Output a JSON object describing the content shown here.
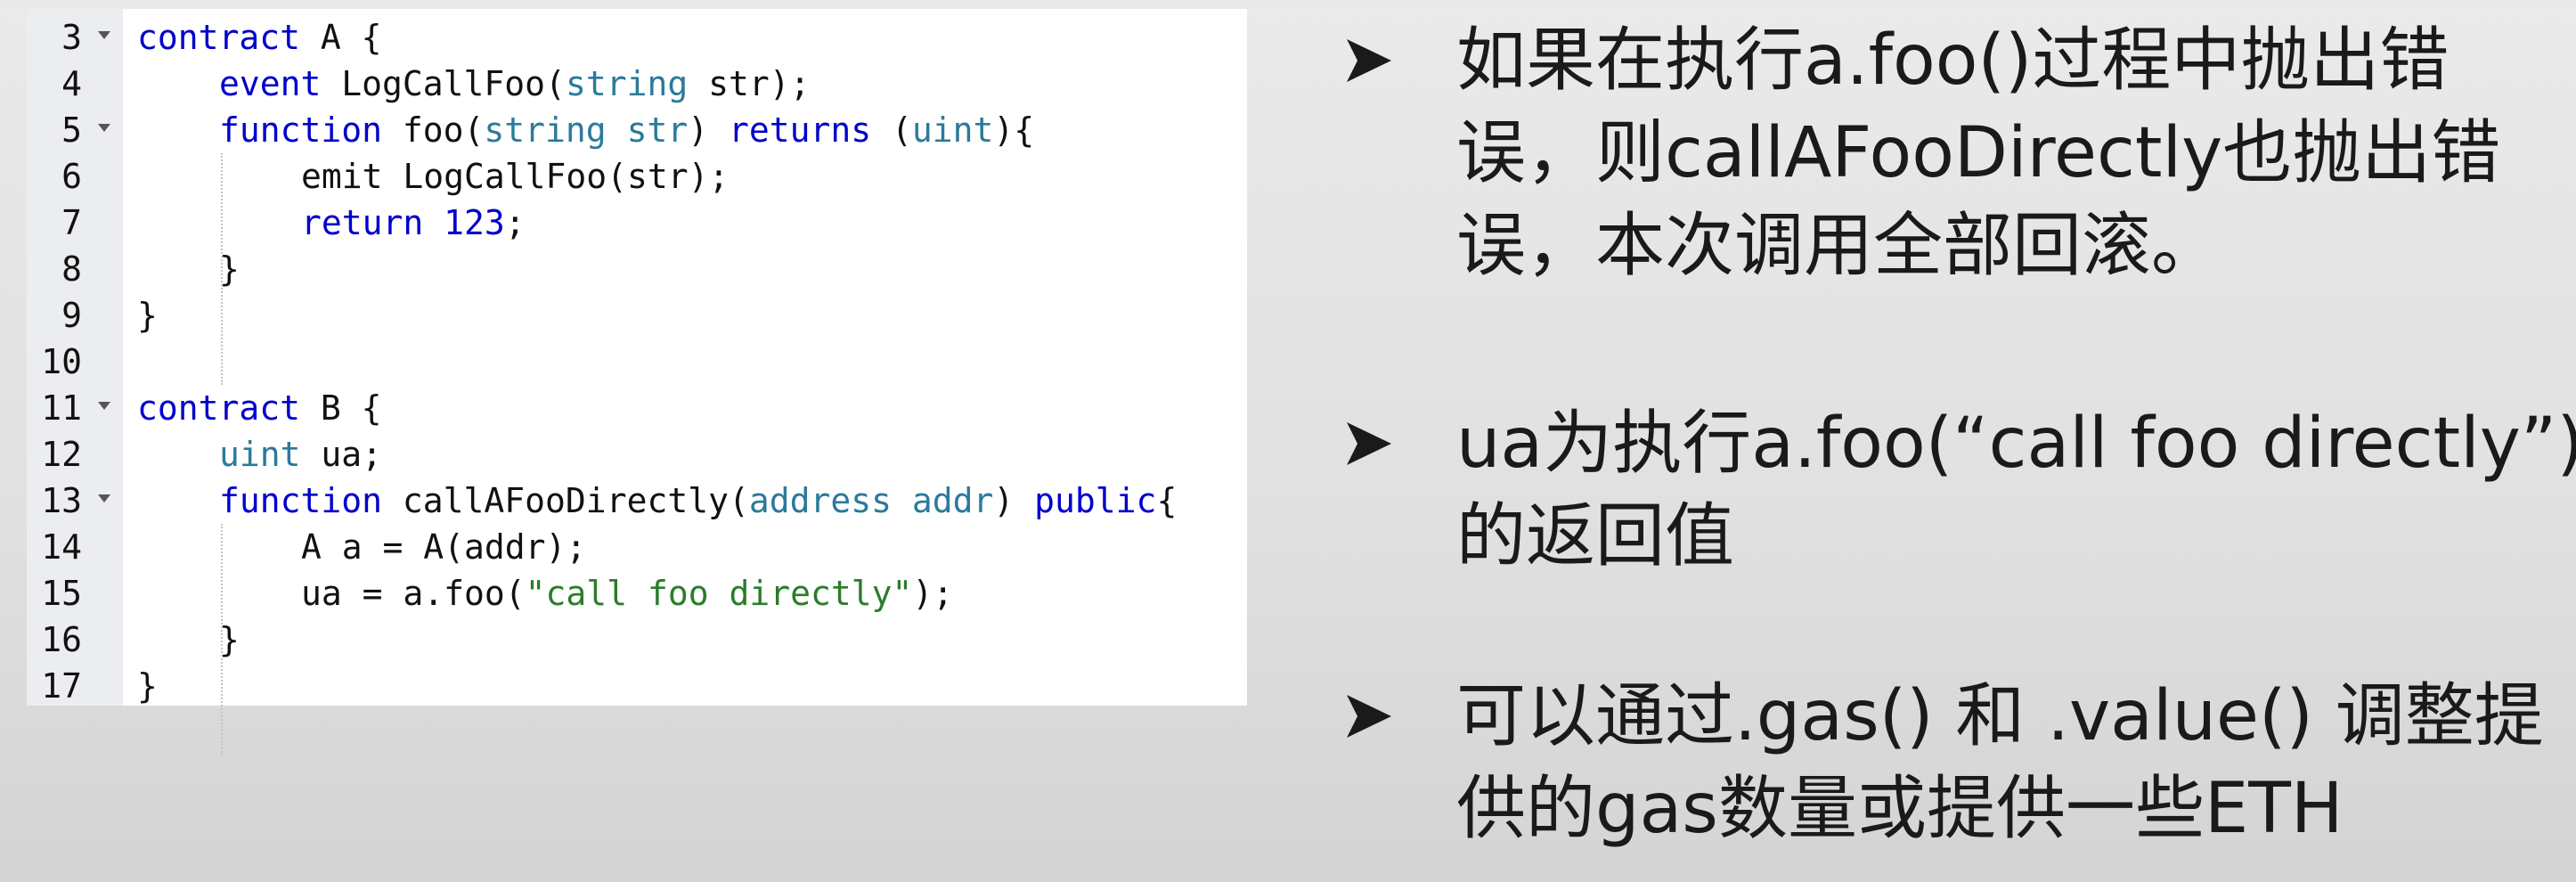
{
  "code": {
    "lines": [
      {
        "num": "3",
        "fold": true,
        "indent": 0,
        "tokens": [
          {
            "t": "contract",
            "c": "kw"
          },
          {
            "t": " A {",
            "c": ""
          }
        ]
      },
      {
        "num": "4",
        "fold": false,
        "indent": 1,
        "tokens": [
          {
            "t": "event",
            "c": "kw"
          },
          {
            "t": " LogCallFoo(",
            "c": ""
          },
          {
            "t": "string",
            "c": "ty"
          },
          {
            "t": " str);",
            "c": ""
          }
        ]
      },
      {
        "num": "5",
        "fold": true,
        "indent": 1,
        "tokens": [
          {
            "t": "function",
            "c": "kw"
          },
          {
            "t": " foo(",
            "c": ""
          },
          {
            "t": "string str",
            "c": "ty"
          },
          {
            "t": ") ",
            "c": ""
          },
          {
            "t": "returns",
            "c": "kw"
          },
          {
            "t": " (",
            "c": ""
          },
          {
            "t": "uint",
            "c": "ty"
          },
          {
            "t": "){",
            "c": ""
          }
        ]
      },
      {
        "num": "6",
        "fold": false,
        "indent": 2,
        "tokens": [
          {
            "t": "emit LogCallFoo(str);",
            "c": ""
          }
        ]
      },
      {
        "num": "7",
        "fold": false,
        "indent": 2,
        "tokens": [
          {
            "t": "return",
            "c": "kw"
          },
          {
            "t": " ",
            "c": ""
          },
          {
            "t": "123",
            "c": "kw"
          },
          {
            "t": ";",
            "c": ""
          }
        ]
      },
      {
        "num": "8",
        "fold": false,
        "indent": 1,
        "tokens": [
          {
            "t": "}",
            "c": ""
          }
        ]
      },
      {
        "num": "9",
        "fold": false,
        "indent": 0,
        "tokens": [
          {
            "t": "}",
            "c": ""
          }
        ]
      },
      {
        "num": "10",
        "fold": false,
        "indent": 0,
        "tokens": []
      },
      {
        "num": "11",
        "fold": true,
        "indent": 0,
        "tokens": [
          {
            "t": "contract",
            "c": "kw"
          },
          {
            "t": " B {",
            "c": ""
          }
        ]
      },
      {
        "num": "12",
        "fold": false,
        "indent": 1,
        "tokens": [
          {
            "t": "uint",
            "c": "ty"
          },
          {
            "t": " ua;",
            "c": ""
          }
        ]
      },
      {
        "num": "13",
        "fold": true,
        "indent": 1,
        "tokens": [
          {
            "t": "function",
            "c": "kw"
          },
          {
            "t": " callAFooDirectly(",
            "c": ""
          },
          {
            "t": "address addr",
            "c": "ty"
          },
          {
            "t": ") ",
            "c": ""
          },
          {
            "t": "public",
            "c": "kw"
          },
          {
            "t": "{",
            "c": ""
          }
        ]
      },
      {
        "num": "14",
        "fold": false,
        "indent": 2,
        "tokens": [
          {
            "t": "A a = A(addr);",
            "c": ""
          }
        ]
      },
      {
        "num": "15",
        "fold": false,
        "indent": 2,
        "tokens": [
          {
            "t": "ua = a.foo(",
            "c": ""
          },
          {
            "t": "\"call foo directly\"",
            "c": "st"
          },
          {
            "t": ");",
            "c": ""
          }
        ]
      },
      {
        "num": "16",
        "fold": false,
        "indent": 1,
        "tokens": [
          {
            "t": "}",
            "c": ""
          }
        ]
      },
      {
        "num": "17",
        "fold": false,
        "indent": 0,
        "tokens": [
          {
            "t": "}",
            "c": ""
          }
        ]
      }
    ]
  },
  "bullets": [
    {
      "lines": [
        "如果在执行a.foo()过程中抛出错",
        "误，则callAFooDirectly也抛出错",
        "误，本次调用全部回滚。"
      ]
    },
    {
      "lines": [
        "ua为执行a.foo(“call foo directly”)",
        "的返回值"
      ]
    },
    {
      "lines": [
        "可以通过.gas() 和 .value() 调整提",
        "供的gas数量或提供一些ETH"
      ]
    }
  ],
  "colors": {
    "keyword": "#0000cc",
    "type": "#2b7a9b",
    "string": "#2a7d2a",
    "gutter": "#ecedf0"
  },
  "icons": {
    "bullet": "arrowhead-bullet-icon",
    "fold": "fold-triangle-icon"
  }
}
